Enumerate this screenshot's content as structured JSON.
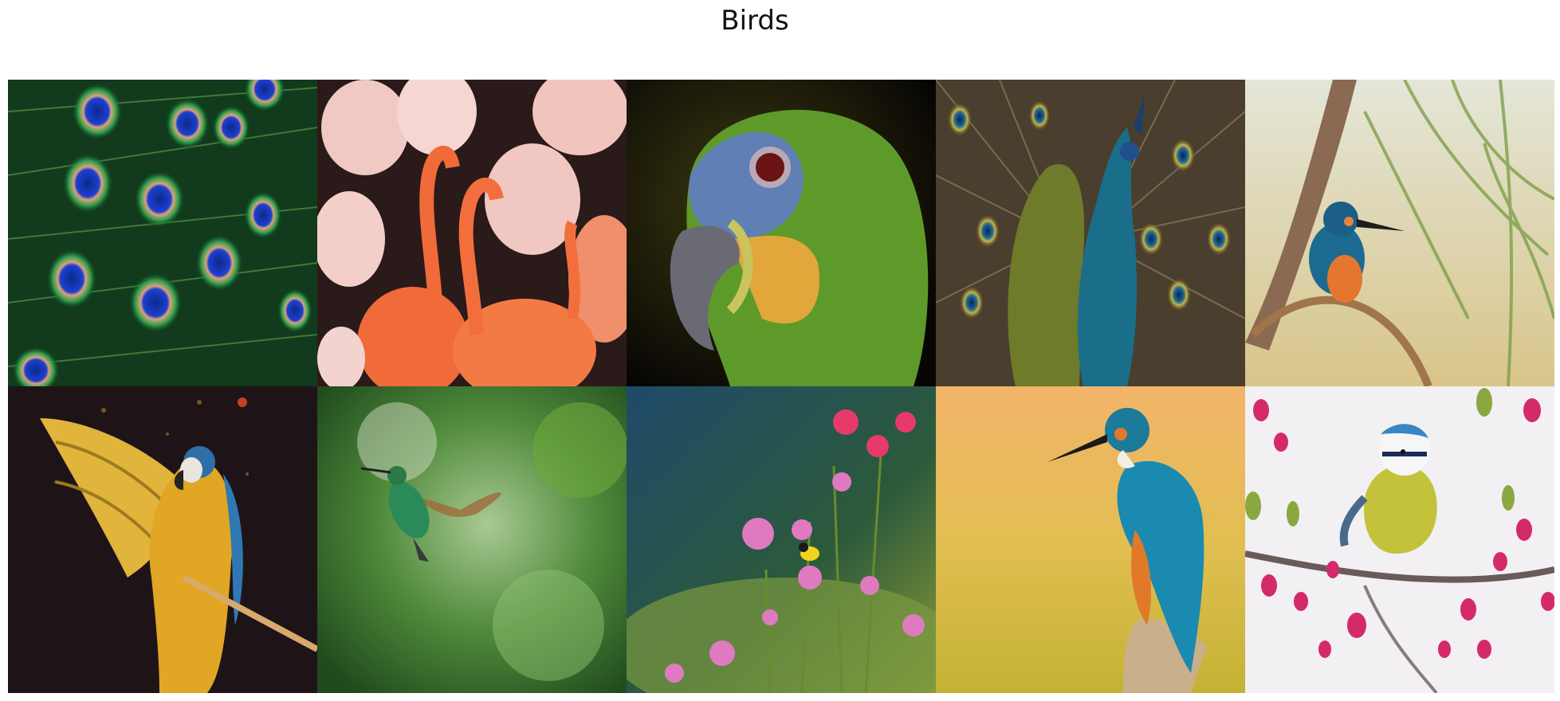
{
  "figure": {
    "title": "Birds",
    "images": [
      {
        "subject": "peacock-feathers",
        "icon": "peacock-feather-icon"
      },
      {
        "subject": "flamingos",
        "icon": "flamingo-icon"
      },
      {
        "subject": "parrot-head",
        "icon": "parrot-icon"
      },
      {
        "subject": "peacock",
        "icon": "peacock-icon"
      },
      {
        "subject": "kingfisher-on-branch",
        "icon": "kingfisher-icon"
      },
      {
        "subject": "macaw",
        "icon": "macaw-icon"
      },
      {
        "subject": "hummingbird",
        "icon": "hummingbird-icon"
      },
      {
        "subject": "goldfinch-in-flowers",
        "icon": "goldfinch-icon"
      },
      {
        "subject": "kingfisher-on-stump",
        "icon": "kingfisher-icon"
      },
      {
        "subject": "blue-tit",
        "icon": "blue-tit-icon"
      }
    ]
  }
}
